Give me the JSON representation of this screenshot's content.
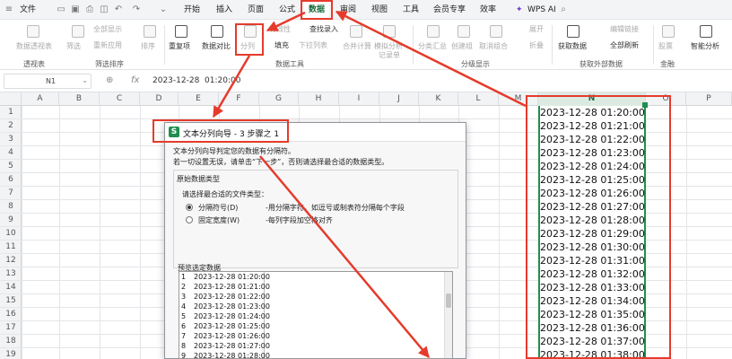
{
  "menu": {
    "file": "文件",
    "tabs": [
      "开始",
      "插入",
      "页面",
      "公式",
      "数据",
      "审阅",
      "视图",
      "工具",
      "会员专享",
      "效率"
    ],
    "wps_ai": "WPS AI"
  },
  "ribbon": {
    "buttons": [
      "数据透视表",
      "筛选",
      "全部显示",
      "重新应用",
      "排序",
      "重复项",
      "数据对比",
      "分列",
      "填充",
      "有效性",
      "下拉列表",
      "查找录入",
      "合并计算",
      "模拟分析",
      "记录单",
      "分类汇总",
      "创建组",
      "取消组合",
      "展开",
      "折叠",
      "获取数据",
      "编辑链接",
      "全部刷新",
      "股票",
      "智能分析"
    ],
    "groups": [
      "透视表",
      "筛选排序",
      "数据工具",
      "分级显示",
      "获取外部数据",
      "金融"
    ]
  },
  "formula_bar": {
    "name_box": "N1",
    "fx": "fx",
    "value": "2023-12-28  01:20:00"
  },
  "columns": [
    "A",
    "B",
    "C",
    "D",
    "E",
    "F",
    "G",
    "H",
    "I",
    "J",
    "K",
    "L",
    "M",
    "N",
    "O",
    "P"
  ],
  "rows": [
    "1",
    "2",
    "3",
    "4",
    "5",
    "6",
    "7",
    "8",
    "9",
    "10",
    "11",
    "12",
    "13",
    "14",
    "15",
    "16",
    "17",
    "18",
    "19"
  ],
  "column_n_values": [
    "2023-12-28 01:20:00",
    "2023-12-28 01:21:00",
    "2023-12-28 01:22:00",
    "2023-12-28 01:23:00",
    "2023-12-28 01:24:00",
    "2023-12-28 01:25:00",
    "2023-12-28 01:26:00",
    "2023-12-28 01:27:00",
    "2023-12-28 01:28:00",
    "2023-12-28 01:29:00",
    "2023-12-28 01:30:00",
    "2023-12-28 01:31:00",
    "2023-12-28 01:32:00",
    "2023-12-28 01:33:00",
    "2023-12-28 01:34:00",
    "2023-12-28 01:35:00",
    "2023-12-28 01:36:00",
    "2023-12-28 01:37:00",
    "2023-12-28 01:38:00"
  ],
  "dialog": {
    "logo": "S",
    "title": "文本分列向导 - 3 步骤之 1",
    "line1": "文本分列向导判定您的数据有分隔符。",
    "line2": "若一切设置无误，请单击“下一步”，否则请选择最合适的数据类型。",
    "section": "原始数据类型",
    "prompt": "请选择最合适的文件类型：",
    "opt1": "分隔符号(D)",
    "opt1_desc": "-用分隔字符，如逗号或制表符分隔每个字段",
    "opt2": "固定宽度(W)",
    "opt2_desc": "-每列字段加空格对齐",
    "preview_label": "预览选定数据",
    "preview": [
      {
        "n": "1",
        "v": "2023-12-28 01:20:00"
      },
      {
        "n": "2",
        "v": "2023-12-28 01:21:00"
      },
      {
        "n": "3",
        "v": "2023-12-28 01:22:00"
      },
      {
        "n": "4",
        "v": "2023-12-28 01:23:00"
      },
      {
        "n": "5",
        "v": "2023-12-28 01:24:00"
      },
      {
        "n": "6",
        "v": "2023-12-28 01:25:00"
      },
      {
        "n": "7",
        "v": "2023-12-28 01:26:00"
      },
      {
        "n": "8",
        "v": "2023-12-28 01:27:00"
      },
      {
        "n": "9",
        "v": "2023-12-28 01:28:00"
      }
    ]
  },
  "colors": {
    "annotation": "#e53b2c",
    "accent": "#1e8f4e",
    "selected_header": "#dcebe2"
  }
}
